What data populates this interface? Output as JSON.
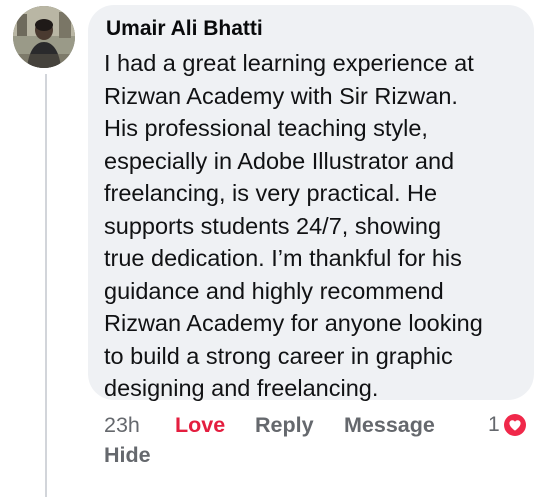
{
  "comment": {
    "author": "Umair Ali Bhatti",
    "text_lines": [
      "I had a great learning experience at",
      "Rizwan Academy with Sir Rizwan.",
      "His professional teaching style,",
      "especially in Adobe Illustrator and",
      "freelancing, is very practical. He",
      "supports students 24/7, showing",
      "true dedication. I’m thankful for his",
      "guidance and highly recommend",
      "Rizwan Academy for anyone looking",
      "to build a strong career in graphic",
      "designing and freelancing."
    ],
    "timestamp": "23h",
    "reaction_count": "1",
    "reaction_icon": "love-heart-icon"
  },
  "actions": {
    "love_label": "Love",
    "reply_label": "Reply",
    "message_label": "Message",
    "hide_label": "Hide"
  },
  "colors": {
    "bubble_background": "#eff1f4",
    "love_red": "#e41e3f",
    "secondary_text": "#65686d",
    "primary_text": "#111214"
  }
}
